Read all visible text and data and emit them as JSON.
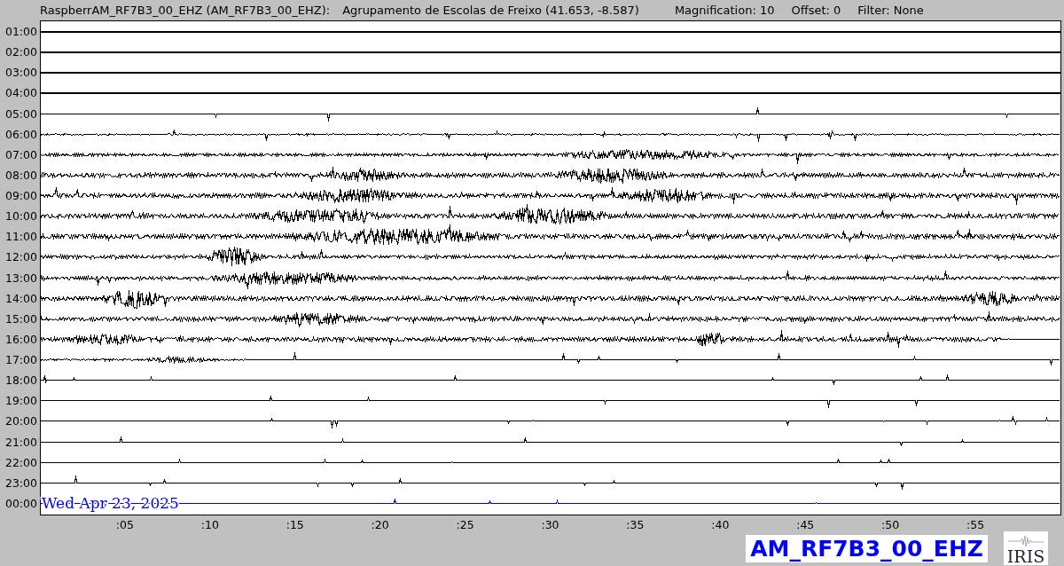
{
  "header": {
    "station": "RaspberrAM_RF7B3_00_EHZ (AM_RF7B3_00_EHZ):",
    "location": "Agrupamento de Escolas de Freixo (41.653, -8.587)",
    "magnification": "Magnification: 10",
    "offset": "Offset: 0",
    "filter": "Filter: None"
  },
  "rows": [
    {
      "label": "01:00",
      "color": "#000000"
    },
    {
      "label": "02:00",
      "color": "#000000"
    },
    {
      "label": "03:00",
      "color": "#000000"
    },
    {
      "label": "04:00",
      "color": "#000000"
    },
    {
      "label": "05:00",
      "color": "#000000"
    },
    {
      "label": "06:00",
      "color": "#000000"
    },
    {
      "label": "07:00",
      "color": "#000000"
    },
    {
      "label": "08:00",
      "color": "#000000"
    },
    {
      "label": "09:00",
      "color": "#000000"
    },
    {
      "label": "10:00",
      "color": "#000000"
    },
    {
      "label": "11:00",
      "color": "#000000"
    },
    {
      "label": "12:00",
      "color": "#000000"
    },
    {
      "label": "13:00",
      "color": "#000000"
    },
    {
      "label": "14:00",
      "color": "#000000"
    },
    {
      "label": "15:00",
      "color": "#000000"
    },
    {
      "label": "16:00",
      "color": "#000000"
    },
    {
      "label": "17:00",
      "color": "#000000"
    },
    {
      "label": "18:00",
      "color": "#000000"
    },
    {
      "label": "19:00",
      "color": "#000000"
    },
    {
      "label": "20:00",
      "color": "#000000"
    },
    {
      "label": "21:00",
      "color": "#000000"
    },
    {
      "label": "22:00",
      "color": "#000000"
    },
    {
      "label": "23:00",
      "color": "#000000"
    },
    {
      "label": "00:00",
      "color": "#0000ff"
    }
  ],
  "date": "Wed Apr 23, 2025",
  "x_ticks": [
    ":05",
    ":10",
    ":15",
    ":20",
    ":25",
    ":30",
    ":35",
    ":40",
    ":45",
    ":50",
    ":55"
  ],
  "station_code": "AM_RF7B3_00_EHZ",
  "logo_text": "IRIS"
}
